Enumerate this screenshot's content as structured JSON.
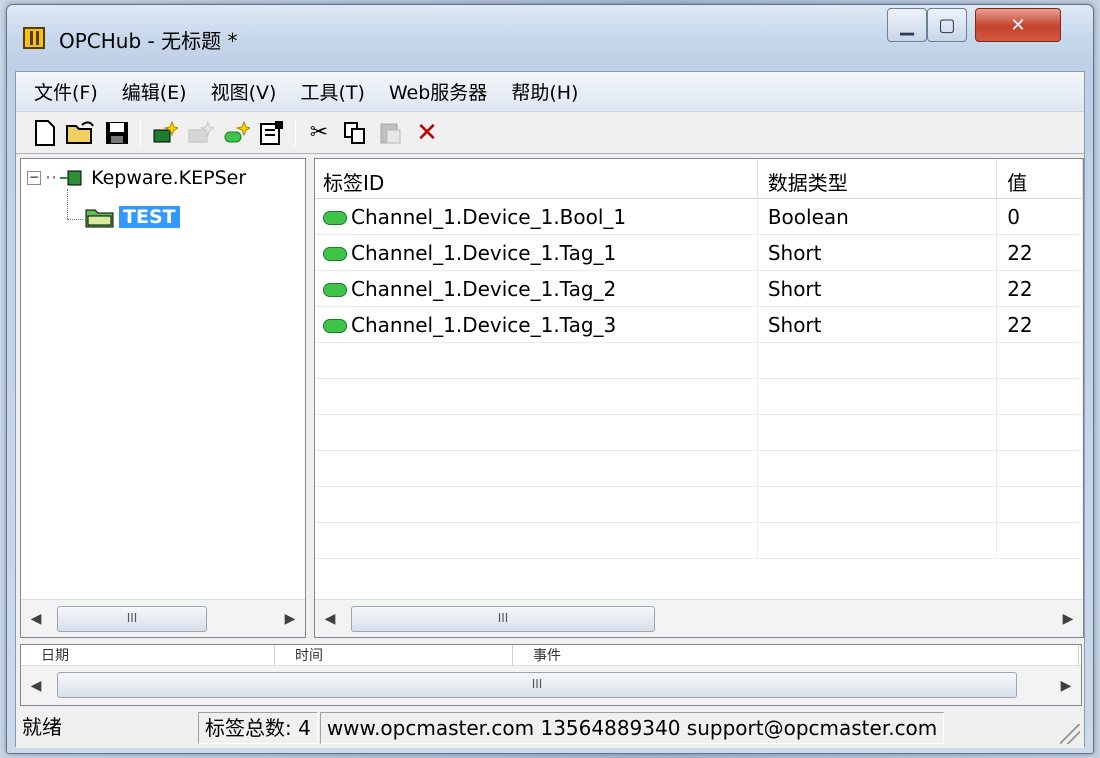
{
  "window": {
    "title": "OPCHub - 无标题 *"
  },
  "menu": [
    "文件(F)",
    "编辑(E)",
    "视图(V)",
    "工具(T)",
    "Web服务器",
    "帮助(H)"
  ],
  "toolbar": {
    "buttons": [
      "new-file",
      "open-folder",
      "save",
      "add-server",
      "add-group-disabled",
      "add-tag",
      "properties",
      "cut",
      "copy",
      "paste-disabled",
      "delete"
    ]
  },
  "tree": {
    "root_label": "Kepware.KEPSer",
    "root_expander": "⊟",
    "child_label": "TEST"
  },
  "list": {
    "columns": [
      "标签ID",
      "数据类型",
      "值"
    ],
    "rows": [
      {
        "id": "Channel_1.Device_1.Bool_1",
        "type": "Boolean",
        "value": "0"
      },
      {
        "id": "Channel_1.Device_1.Tag_1",
        "type": "Short",
        "value": "22"
      },
      {
        "id": "Channel_1.Device_1.Tag_2",
        "type": "Short",
        "value": "22"
      },
      {
        "id": "Channel_1.Device_1.Tag_3",
        "type": "Short",
        "value": "22"
      }
    ]
  },
  "log": {
    "columns": [
      "日期",
      "时间",
      "事件"
    ]
  },
  "scrollbar": {
    "thumb_grip": "III",
    "left_arrow": "◀",
    "right_arrow": "▶"
  },
  "statusbar": {
    "ready": "就绪",
    "tag_count": "标签总数: 4",
    "contact": "www.opcmaster.com 13564889340 support@opcmaster.com"
  },
  "colors": {
    "selection": "#3399ff",
    "tag_icon": "#3ec449"
  }
}
